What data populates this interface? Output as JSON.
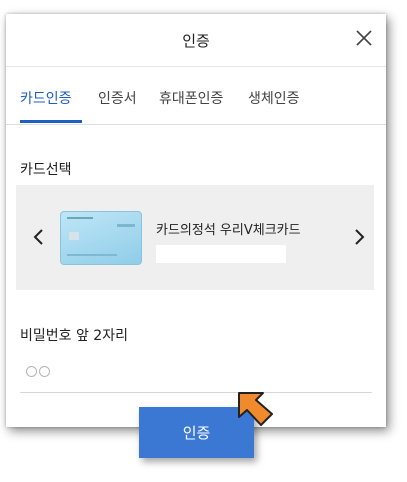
{
  "dialog": {
    "title": "인증",
    "close_icon": "close-icon"
  },
  "tabs": [
    {
      "label": "카드인증",
      "active": true
    },
    {
      "label": "인증서",
      "active": false
    },
    {
      "label": "휴대폰인증",
      "active": false
    },
    {
      "label": "생체인증",
      "active": false
    }
  ],
  "card_section": {
    "label": "카드선택",
    "selected_card_name": "카드의정석 우리V체크카드",
    "prev_icon": "chevron-left-icon",
    "next_icon": "chevron-right-icon"
  },
  "password_section": {
    "label": "비밀번호 앞 2자리"
  },
  "submit_button": {
    "label": "인증"
  },
  "colors": {
    "accent": "#1f5fbf",
    "button": "#3b78d4",
    "pointer": "#f08a2c"
  }
}
